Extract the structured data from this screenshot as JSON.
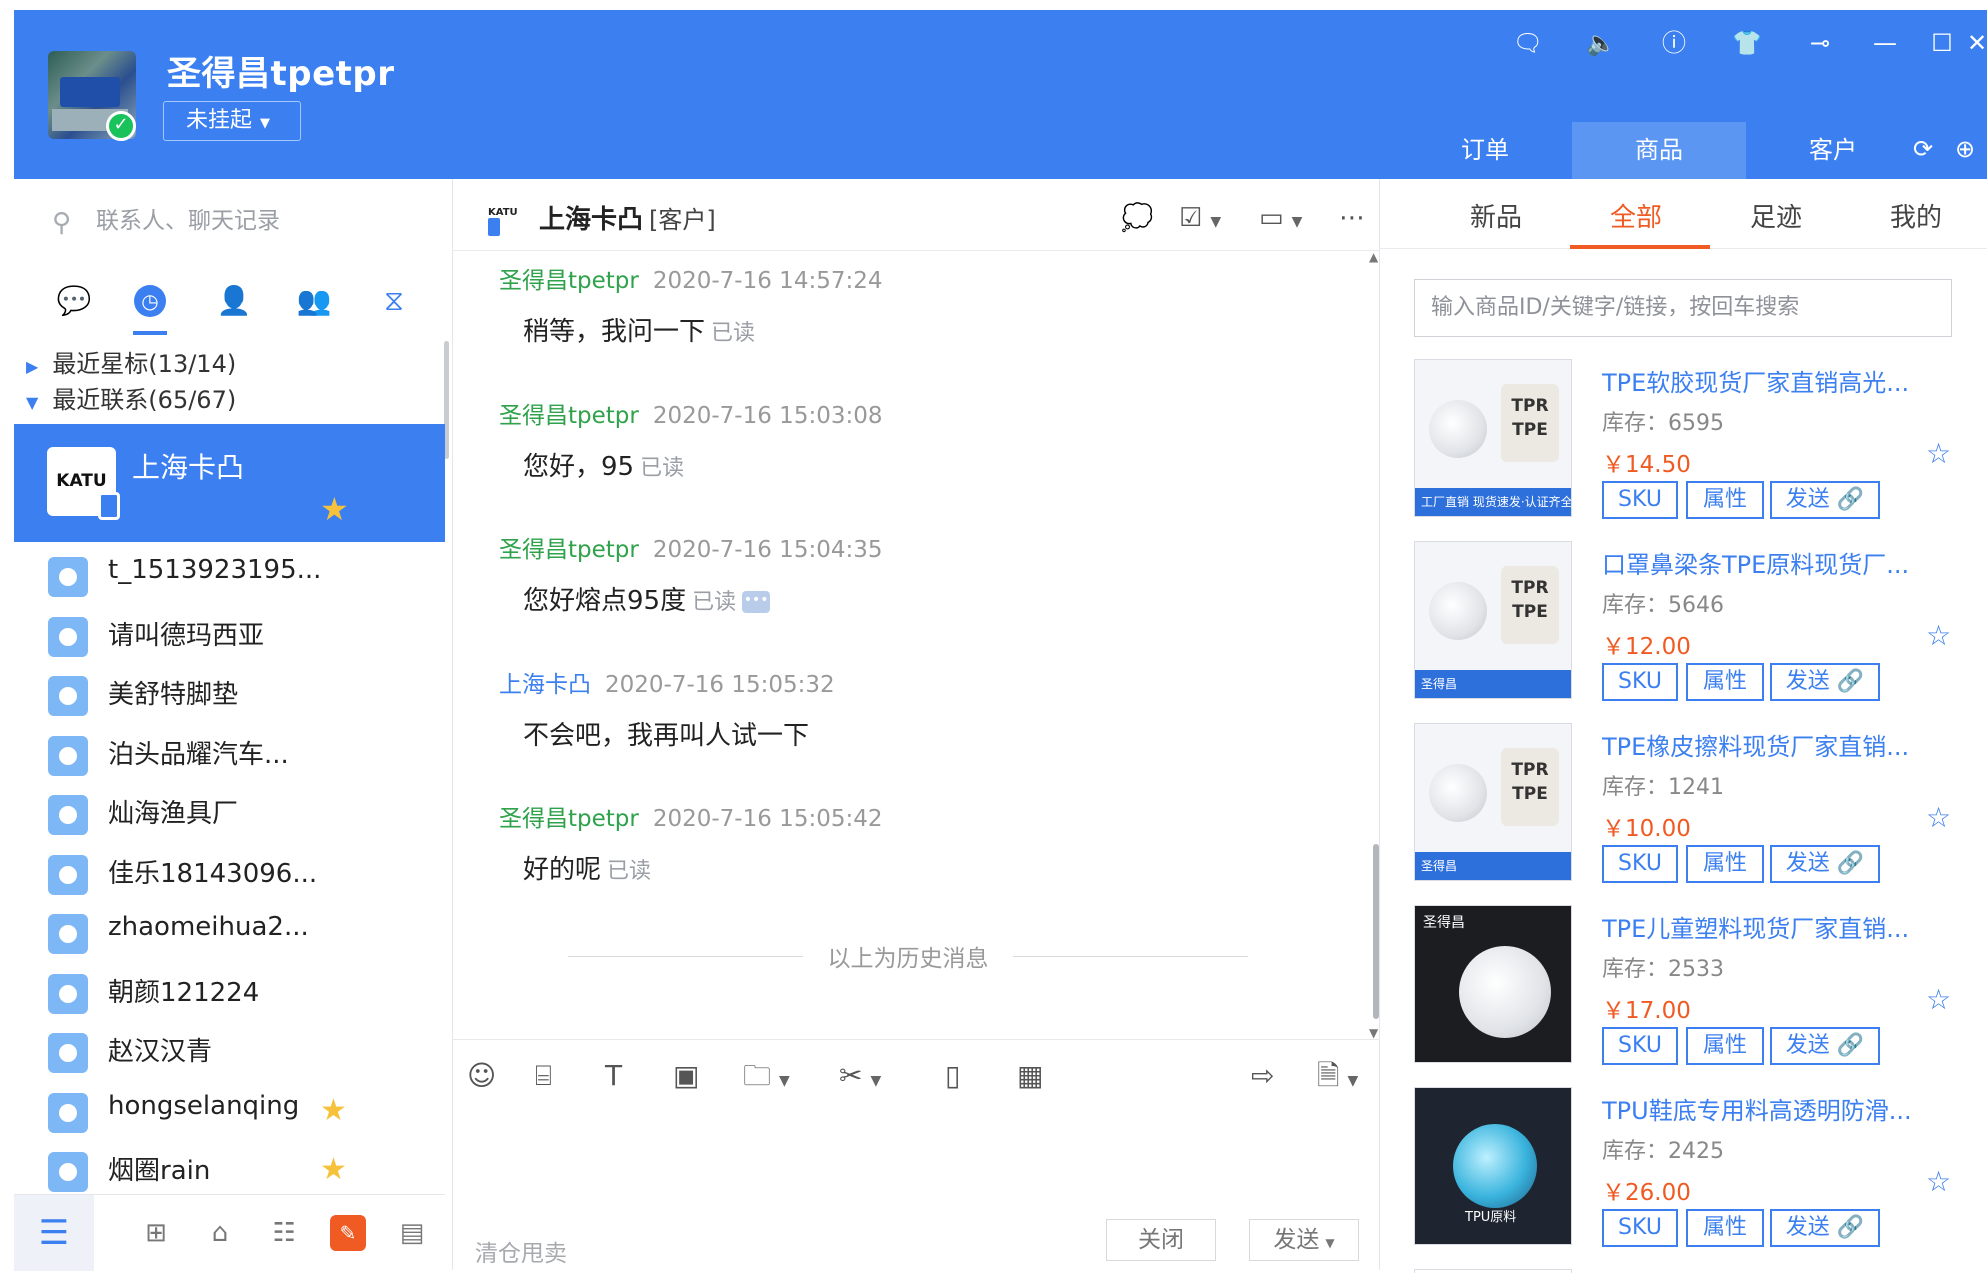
{
  "header": {
    "user_name": "圣得昌tpetpr",
    "status_label": "未挂起",
    "nav_tabs": [
      "订单",
      "商品",
      "客户"
    ]
  },
  "left": {
    "search_placeholder": "联系人、聊天记录",
    "groups": [
      "最近星标(13/14)",
      "最近联系(65/67)"
    ],
    "selected_contact": {
      "name": "上海卡凸",
      "logo_text": "KATU",
      "starred": true
    },
    "contacts": [
      {
        "name": "t_1513923195...",
        "starred": false
      },
      {
        "name": "请叫德玛西亚",
        "starred": false
      },
      {
        "name": "美舒特脚垫",
        "starred": false
      },
      {
        "name": "泊头品耀汽车...",
        "starred": false
      },
      {
        "name": "灿海渔具厂",
        "starred": false
      },
      {
        "name": "佳乐18143096...",
        "starred": false
      },
      {
        "name": "zhaomeihua2...",
        "starred": false
      },
      {
        "name": "朝颜121224",
        "starred": false
      },
      {
        "name": "赵汉汉青",
        "starred": false
      },
      {
        "name": "hongselanqing",
        "starred": true
      },
      {
        "name": "烟圈rain",
        "starred": true
      }
    ]
  },
  "chat": {
    "contact_name": "上海卡凸",
    "contact_tag": "[客户]",
    "logo_text": "KATU",
    "messages": [
      {
        "sender": "圣得昌tpetpr",
        "self": true,
        "time": "2020-7-16 14:57:24",
        "text": "稍等，我问一下",
        "read": "已读"
      },
      {
        "sender": "圣得昌tpetpr",
        "self": true,
        "time": "2020-7-16 15:03:08",
        "text": "您好，95",
        "read": "已读"
      },
      {
        "sender": "圣得昌tpetpr",
        "self": true,
        "time": "2020-7-16 15:04:35",
        "text": "您好熔点95度",
        "read": "已读"
      },
      {
        "sender": "上海卡凸",
        "self": false,
        "time": "2020-7-16 15:05:32",
        "text": "不会吧，我再叫人试一下",
        "read": ""
      },
      {
        "sender": "圣得昌tpetpr",
        "self": true,
        "time": "2020-7-16 15:05:42",
        "text": "好的呢",
        "read": "已读"
      }
    ],
    "history_divider": "以上为历史消息",
    "input_placeholder": "清仓甩卖",
    "close_label": "关闭",
    "send_label": "发送"
  },
  "goods": {
    "tabs": [
      "新品",
      "全部",
      "足迹",
      "我的"
    ],
    "search_placeholder": "输入商品ID/关键字/链接，按回车搜索",
    "stock_label": "库存：",
    "buttons": [
      "SKU",
      "属性",
      "发送"
    ],
    "items": [
      {
        "title": "TPE软胶现货厂家直销高光...",
        "stock": "6595",
        "price": "￥14.50",
        "img_bag": "TPR TPE",
        "img_band": "工厂直销 现货速发·认证齐全"
      },
      {
        "title": "口罩鼻梁条TPE原料现货厂...",
        "stock": "5646",
        "price": "￥12.00",
        "img_bag": "TPR TPE",
        "img_band": "圣得昌"
      },
      {
        "title": "TPE橡皮擦料现货厂家直销...",
        "stock": "1241",
        "price": "￥10.00",
        "img_bag": "TPR TPE",
        "img_band": "圣得昌"
      },
      {
        "title": "TPE儿童塑料现货厂家直销...",
        "stock": "2533",
        "price": "￥17.00",
        "img_bag": "",
        "img_band": "圣得昌"
      },
      {
        "title": "TPU鞋底专用料高透明防滑...",
        "stock": "2425",
        "price": "￥26.00",
        "img_bag": "",
        "img_band": "TPU原料"
      }
    ]
  }
}
